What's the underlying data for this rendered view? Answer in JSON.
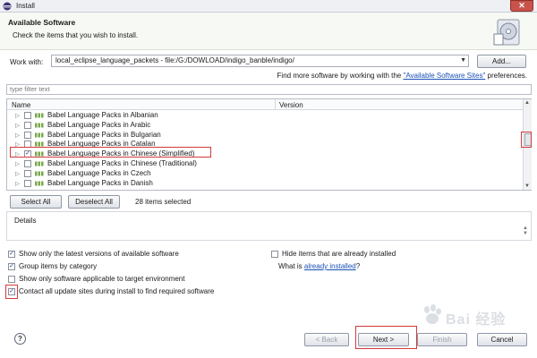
{
  "window": {
    "title": "Install"
  },
  "banner": {
    "heading": "Available Software",
    "description": "Check the items that you wish to install."
  },
  "work_with": {
    "label": "Work with:",
    "value": "local_eclipse_language_packets - file:/G:/DOWLOAD/indigo_banble/indigo/",
    "add_label": "Add..."
  },
  "find_more": {
    "prefix": "Find more software by working with the ",
    "link": "\"Available Software Sites\"",
    "suffix": " preferences."
  },
  "filter": {
    "placeholder": "type filter text"
  },
  "tree": {
    "columns": {
      "name": "Name",
      "version": "Version"
    },
    "rows": [
      {
        "label": "Babel Language Packs in Albanian",
        "checked": false
      },
      {
        "label": "Babel Language Packs in Arabic",
        "checked": false
      },
      {
        "label": "Babel Language Packs in Bulgarian",
        "checked": false
      },
      {
        "label": "Babel Language Packs in Catalan",
        "checked": false
      },
      {
        "label": "Babel Language Packs in Chinese (Simplified)",
        "checked": true
      },
      {
        "label": "Babel Language Packs in Chinese (Traditional)",
        "checked": false
      },
      {
        "label": "Babel Language Packs in Czech",
        "checked": false
      },
      {
        "label": "Babel Language Packs in Danish",
        "checked": false
      }
    ]
  },
  "selection": {
    "select_all": "Select All",
    "deselect_all": "Deselect All",
    "count_text": "28 items selected"
  },
  "details": {
    "label": "Details"
  },
  "options": {
    "latest": {
      "label": "Show only the latest versions of available software",
      "checked": true
    },
    "group": {
      "label": "Group items by category",
      "checked": true
    },
    "target": {
      "label": "Show only software applicable to target environment",
      "checked": false
    },
    "contact": {
      "label": "Contact all update sites during install to find required software",
      "checked": true
    },
    "hide": {
      "label": "Hide items that are already installed",
      "checked": false
    }
  },
  "what_is": {
    "prefix": "What is ",
    "link": "already installed",
    "suffix": "?"
  },
  "footer": {
    "back": "< Back",
    "next": "Next >",
    "finish": "Finish",
    "cancel": "Cancel"
  },
  "watermark": {
    "text": "Bai 经验"
  },
  "colors": {
    "highlight": "#d23a3a",
    "link": "#1a4fb8",
    "banner_bg": "#f7faf4"
  }
}
